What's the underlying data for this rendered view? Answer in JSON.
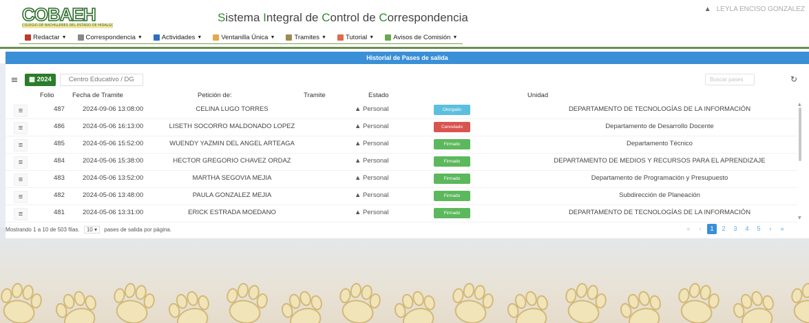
{
  "header": {
    "logo_text": "COBAEH",
    "logo_sub": "COLEGIO DE BACHILLERES DEL ESTADO DE HIDALGO",
    "title_parts": [
      "S",
      "istema ",
      "I",
      "ntegral de ",
      "C",
      "ontrol de ",
      "C",
      "orrespondencia"
    ],
    "user_name": "LEYLA ENCISO GONZALEZ"
  },
  "menu": [
    {
      "label": "Redactar",
      "color": "#c0392b"
    },
    {
      "label": "Correspondencia",
      "color": "#888888"
    },
    {
      "label": "Actividades",
      "color": "#2c6fbf"
    },
    {
      "label": "Ventanilla Única",
      "color": "#e5a84a"
    },
    {
      "label": "Tramites",
      "color": "#a08a50"
    },
    {
      "label": "Tutorial",
      "color": "#e06a4a"
    },
    {
      "label": "Avisos de Comisión",
      "color": "#6aa84f"
    }
  ],
  "panel": {
    "heading": "Historial de Pases de salida",
    "year": "2024",
    "center": "Centro Educativo / DG",
    "search_placeholder": "Buscar pases"
  },
  "columns": {
    "folio": "Folio",
    "fecha": "Fecha de Tramite",
    "peticion": "Petición de:",
    "tramite": "Tramite",
    "estado": "Estado",
    "unidad": "Unidad"
  },
  "rows": [
    {
      "folio": "487",
      "fecha": "2024-09-06 13:08:00",
      "peticion": "CELINA LUGO TORRES",
      "tramite": "Personal",
      "estado": "Otorgado",
      "estado_color": "#5bc0de",
      "unidad": "DEPARTAMENTO DE TECNOLOGÍAS DE LA INFORMACIÓN"
    },
    {
      "folio": "486",
      "fecha": "2024-05-06 16:13:00",
      "peticion": "LISETH SOCORRO MALDONADO LOPEZ",
      "tramite": "Personal",
      "estado": "Cancelado",
      "estado_color": "#d9534f",
      "unidad": "Departamento de Desarrollo Docente"
    },
    {
      "folio": "485",
      "fecha": "2024-05-06 15:52:00",
      "peticion": "WUENDY YAZMIN DEL ANGEL ARTEAGA",
      "tramite": "Personal",
      "estado": "Firmado",
      "estado_color": "#5cb85c",
      "unidad": "Departamento Técnico"
    },
    {
      "folio": "484",
      "fecha": "2024-05-06 15:38:00",
      "peticion": "HECTOR GREGORIO CHAVEZ ORDAZ",
      "tramite": "Personal",
      "estado": "Firmado",
      "estado_color": "#5cb85c",
      "unidad": "DEPARTAMENTO DE MEDIOS Y RECURSOS PARA EL APRENDIZAJE"
    },
    {
      "folio": "483",
      "fecha": "2024-05-06 13:52:00",
      "peticion": "MARTHA SEGOVIA MEJIA",
      "tramite": "Personal",
      "estado": "Firmado",
      "estado_color": "#5cb85c",
      "unidad": "Departamento de Programación y Presupuesto"
    },
    {
      "folio": "482",
      "fecha": "2024-05-06 13:48:00",
      "peticion": "PAULA GONZALEZ MEJIA",
      "tramite": "Personal",
      "estado": "Firmado",
      "estado_color": "#5cb85c",
      "unidad": "Subdirección de Planeación"
    },
    {
      "folio": "481",
      "fecha": "2024-05-06 13:31:00",
      "peticion": "ERICK ESTRADA MOEDANO",
      "tramite": "Personal",
      "estado": "Firmado",
      "estado_color": "#5cb85c",
      "unidad": "DEPARTAMENTO DE TECNOLOGÍAS DE LA INFORMACIÓN"
    }
  ],
  "footer": {
    "showing": "Mostrando 1 a 10 de 503 filas.",
    "per_page": "10",
    "per_page_suffix": "pases de salida por página."
  },
  "pagination": {
    "first": "«",
    "prev": "‹",
    "pages": [
      "1",
      "2",
      "3",
      "4",
      "5"
    ],
    "active": "1",
    "next": "›",
    "last": "»"
  }
}
